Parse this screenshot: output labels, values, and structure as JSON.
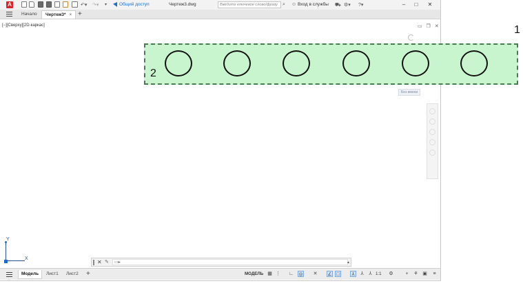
{
  "app": {
    "logo_letter": "A",
    "share_label": "Общий доступ",
    "document_title": "Чертеж3.dwg",
    "search_placeholder": "Введите ключевое слово/фразу",
    "signin_label": "Вход в службы"
  },
  "tabs": [
    {
      "label": "Начало",
      "active": false
    },
    {
      "label": "Чертеж3*",
      "active": true
    }
  ],
  "tab_close_glyph": "×",
  "new_tab_glyph": "+",
  "viewport": {
    "view_label": "[−][Сверху][2D-каркас]",
    "named_view_label": "Без имени"
  },
  "annotations": {
    "label_1": "1",
    "label_2": "2"
  },
  "drawing": {
    "circle_count": 6,
    "selection_fill": "#c8f5cd",
    "selection_border": "#4a7a52"
  },
  "ucs": {
    "x_label": "X",
    "y_label": "Y"
  },
  "command_line": {
    "prompt": "▭▸"
  },
  "status": {
    "layout_tabs": [
      {
        "label": "Модель",
        "active": true
      },
      {
        "label": "Лист1",
        "active": false
      },
      {
        "label": "Лист2",
        "active": false
      }
    ],
    "model_button": "МОДЕЛЬ",
    "scale": "1:1"
  },
  "colors": {
    "accent": "#d9262c",
    "link": "#1a6fd6"
  }
}
